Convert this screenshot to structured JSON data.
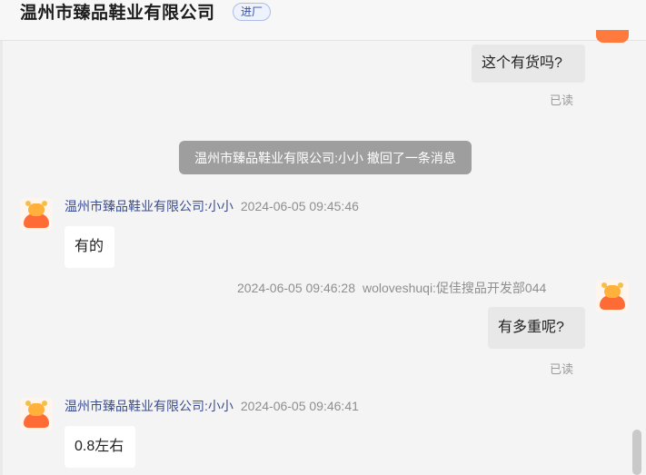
{
  "header": {
    "title": "温州市臻品鞋业有限公司",
    "badge": "进厂"
  },
  "messages": [
    {
      "direction": "outgoing",
      "text": "这个有货吗?",
      "status": "已读"
    },
    {
      "type": "system",
      "text": "温州市臻品鞋业有限公司:小小 撤回了一条消息"
    },
    {
      "direction": "incoming",
      "sender": "温州市臻品鞋业有限公司:小小",
      "time": "2024-06-05 09:45:46",
      "text": "有的"
    },
    {
      "direction": "outgoing",
      "sender": "woloveshuqi:促佳搜品开发部044",
      "time": "2024-06-05 09:46:28",
      "text": "有多重呢?",
      "status": "已读"
    },
    {
      "direction": "incoming",
      "sender": "温州市臻品鞋业有限公司:小小",
      "time": "2024-06-05 09:46:41",
      "text": "0.8左右"
    }
  ],
  "colors": {
    "accent": "#3553a6",
    "avatar": "#ff6b35",
    "system_bg": "#9e9e9e"
  }
}
